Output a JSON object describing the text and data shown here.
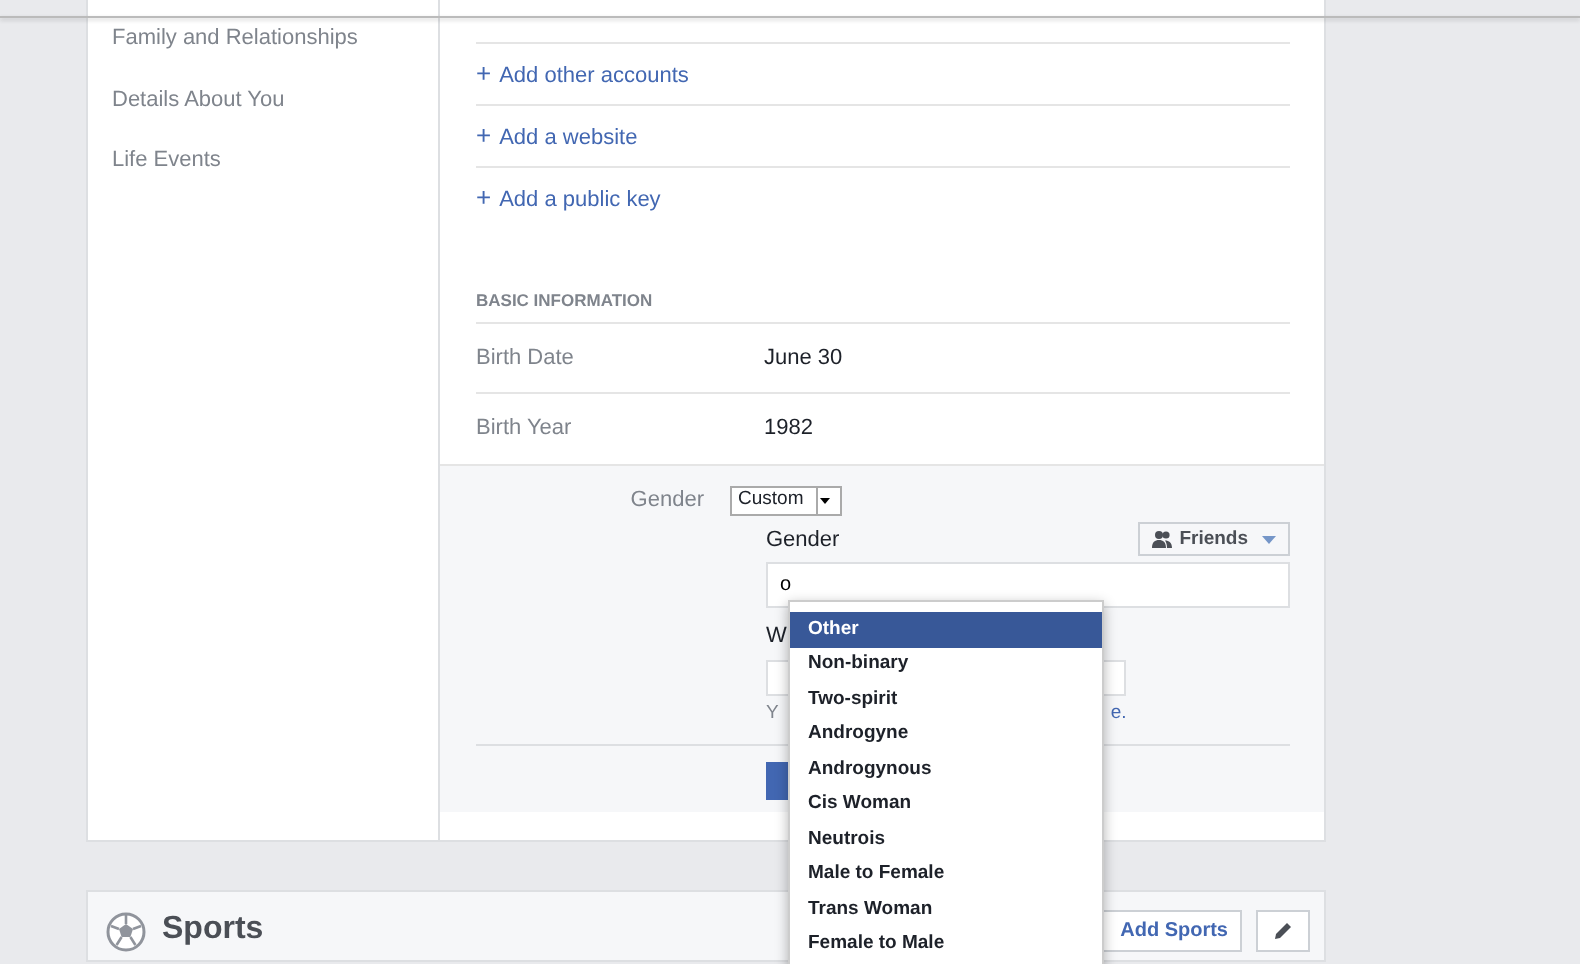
{
  "sidebar": {
    "items": [
      {
        "label": "Family and Relationships"
      },
      {
        "label": "Details About You"
      },
      {
        "label": "Life Events"
      }
    ]
  },
  "contact_links": [
    {
      "icon": "+",
      "label": "Add other accounts"
    },
    {
      "icon": "+",
      "label": "Add a website"
    },
    {
      "icon": "+",
      "label": "Add a public key"
    }
  ],
  "basic_information": {
    "heading": "BASIC INFORMATION",
    "rows": [
      {
        "label": "Birth Date",
        "value": "June 30"
      },
      {
        "label": "Birth Year",
        "value": "1982"
      }
    ]
  },
  "gender_editor": {
    "label": "Gender",
    "select_value": "Custom",
    "custom_label": "Gender",
    "audience_button": "Friends",
    "input_value": "o",
    "partial_label": "W",
    "partial_hint_start": "Y",
    "partial_hint_end": "e.",
    "suggestions": [
      {
        "label": "Other",
        "selected": true
      },
      {
        "label": "Non-binary",
        "selected": false
      },
      {
        "label": "Two-spirit",
        "selected": false
      },
      {
        "label": "Androgyne",
        "selected": false
      },
      {
        "label": "Androgynous",
        "selected": false
      },
      {
        "label": "Cis Woman",
        "selected": false
      },
      {
        "label": "Neutrois",
        "selected": false
      },
      {
        "label": "Male to Female",
        "selected": false
      },
      {
        "label": "Trans Woman",
        "selected": false
      },
      {
        "label": "Female to Male",
        "selected": false
      }
    ]
  },
  "sports": {
    "title": "Sports",
    "add_button": "Add Sports"
  }
}
